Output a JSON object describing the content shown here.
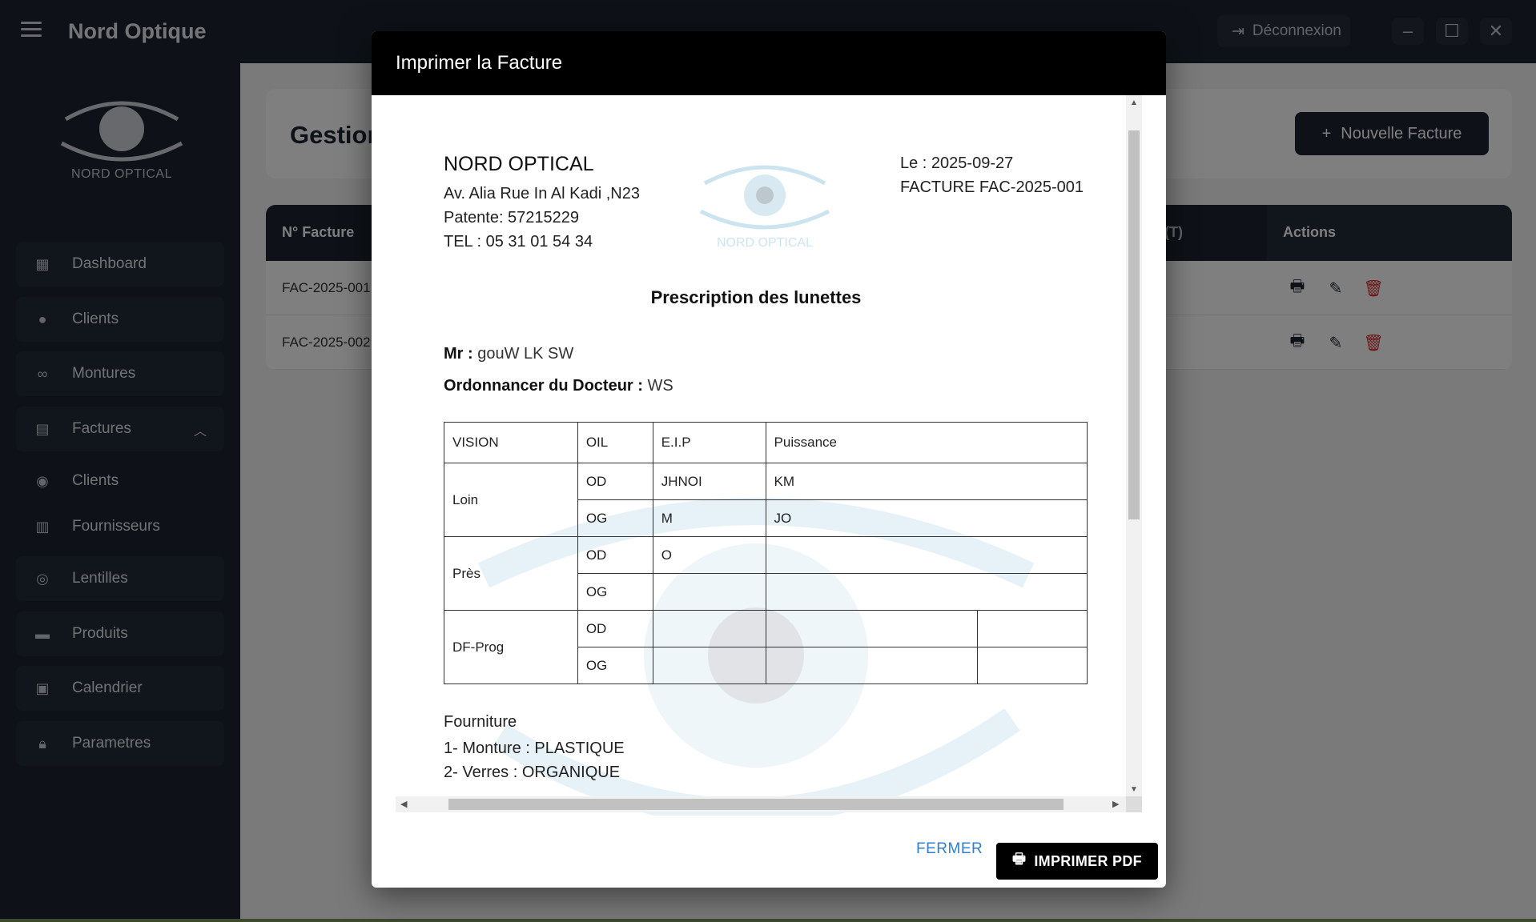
{
  "app": {
    "title": "Nord Optique",
    "logout_label": "Déconnexion",
    "logo_text": "NORD OPTICAL"
  },
  "sidebar": {
    "items": [
      {
        "label": "Dashboard",
        "icon": "dashboard-icon"
      },
      {
        "label": "Clients",
        "icon": "person-icon"
      },
      {
        "label": "Montures",
        "icon": "glasses-icon"
      },
      {
        "label": "Factures",
        "icon": "receipt-icon",
        "expanded": true
      },
      {
        "label": "Clients",
        "icon": "account-circle-icon",
        "sub": true
      },
      {
        "label": "Fournisseurs",
        "icon": "building-icon",
        "sub": true
      },
      {
        "label": "Lentilles",
        "icon": "eye-icon"
      },
      {
        "label": "Produits",
        "icon": "archive-icon"
      },
      {
        "label": "Calendrier",
        "icon": "calendar-icon"
      },
      {
        "label": "Parametres",
        "icon": "lock-icon"
      }
    ]
  },
  "main": {
    "page_title": "Gestion",
    "new_button_label": "Nouvelle Facture",
    "table": {
      "col_number": "N° Facture",
      "col_partial": "(T)",
      "col_actions": "Actions",
      "rows": [
        "FAC-2025-001",
        "FAC-2025-002"
      ]
    }
  },
  "dialog": {
    "title": "Imprimer la Facture",
    "company": {
      "name": "NORD OPTICAL",
      "address": "Av. Alia Rue In Al Kadi ,N23",
      "patente": "Patente: 57215229",
      "tel": "TEL : 05 31 01 54 34"
    },
    "watermark_text": "NORD OPTICAL",
    "date_line": "Le : 2025-09-27",
    "invoice_line": "FACTURE FAC-2025-001",
    "heading": "Prescription des lunettes",
    "mr_label": "Mr :",
    "mr_value": "gouW LK SW",
    "doctor_label": "Ordonnancer du Docteur :",
    "doctor_value": "WS",
    "rx_table": {
      "headers": [
        "VISION",
        "OIL",
        "E.I.P",
        "Puissance"
      ],
      "loin": {
        "label": "Loin",
        "od": {
          "eye": "OD",
          "eip": "JHNOI",
          "p": "KM"
        },
        "og": {
          "eye": "OG",
          "eip": "M",
          "p": "JO"
        }
      },
      "pres": {
        "label": "Près",
        "od": {
          "eye": "OD",
          "eip": "O",
          "p": ""
        },
        "og": {
          "eye": "OG",
          "eip": "",
          "p": ""
        }
      },
      "dfprog": {
        "label": "DF-Prog",
        "od": {
          "eye": "OD"
        },
        "og": {
          "eye": "OG"
        }
      }
    },
    "fourniture": {
      "title": "Fourniture",
      "monture": "1- Monture : PLASTIQUE",
      "verres": "2- Verres : ORGANIQUE"
    },
    "close_label": "FERMER",
    "print_label": "IMPRIMER PDF"
  },
  "colors": {
    "dark": "#1c2431",
    "accent_link": "#2f7fd1",
    "delete": "#d32f2f"
  }
}
